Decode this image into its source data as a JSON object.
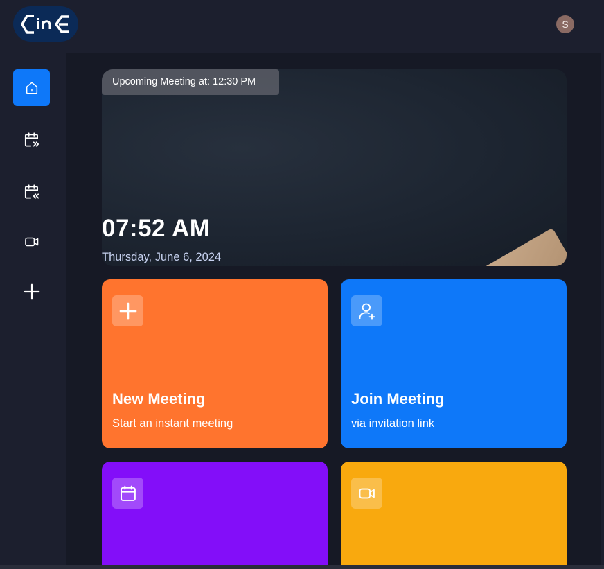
{
  "header": {
    "logo_text": "cinE",
    "avatar_initial": "S"
  },
  "sidebar": {
    "items": [
      {
        "name": "home",
        "icon": "home-icon",
        "active": true
      },
      {
        "name": "upcoming",
        "icon": "calendar-upcoming-icon",
        "active": false
      },
      {
        "name": "previous",
        "icon": "calendar-previous-icon",
        "active": false
      },
      {
        "name": "recordings",
        "icon": "video-icon",
        "active": false
      },
      {
        "name": "personal-room",
        "icon": "plus-icon",
        "active": false
      }
    ]
  },
  "hero": {
    "badge": "Upcoming Meeting at: 12:30 PM",
    "time": "07:52 AM",
    "date": "Thursday, June 6, 2024"
  },
  "cards": [
    {
      "title": "New Meeting",
      "subtitle": "Start an instant meeting",
      "icon": "plus-icon",
      "color": "#ff742e"
    },
    {
      "title": "Join Meeting",
      "subtitle": "via invitation link",
      "icon": "user-add-icon",
      "color": "#0e78f9"
    },
    {
      "title": "",
      "subtitle": "",
      "icon": "calendar-icon",
      "color": "#830ef9"
    },
    {
      "title": "",
      "subtitle": "",
      "icon": "video-icon",
      "color": "#f9a90e"
    }
  ],
  "colors": {
    "background": "#1c1f2e",
    "main_bg": "#161925",
    "accent_blue": "#0e78f9",
    "avatar": "#8a6a63"
  }
}
